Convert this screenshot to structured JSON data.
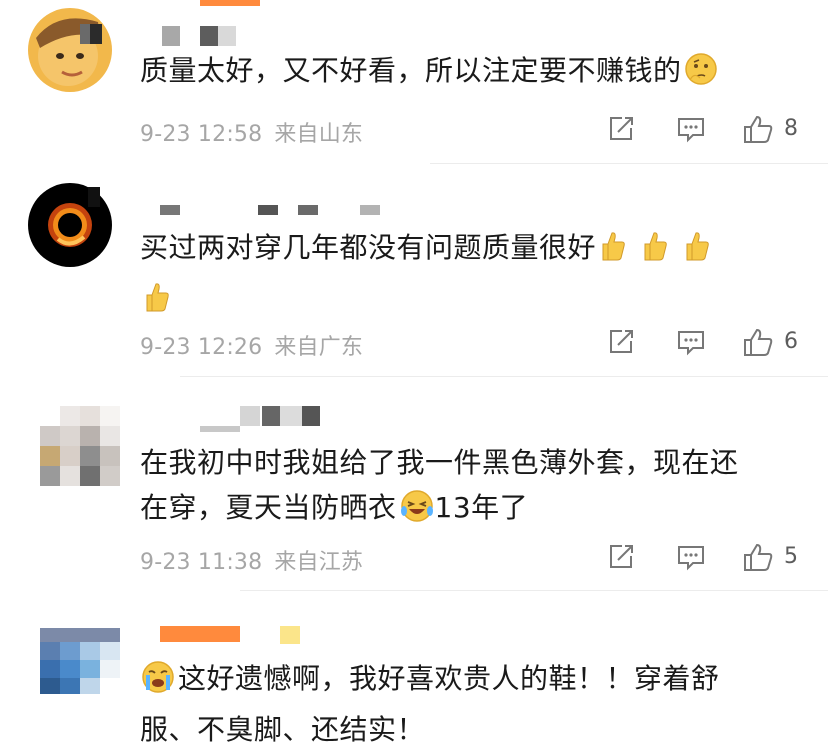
{
  "comments": [
    {
      "text": "质量太好，又不好看，所以注定要不赚钱的",
      "time": "9-23 12:58",
      "location": "来自山东",
      "likes": "8"
    },
    {
      "text": "买过两对穿几年都没有问题质量很好",
      "time": "9-23 12:26",
      "location": "来自广东",
      "likes": "6"
    },
    {
      "text_line1": "在我初中时我姐给了我一件黑色薄外套，现在还",
      "text_line2a": "在穿，夏天当防晒衣",
      "text_line2b": "13年了",
      "time": "9-23 11:38",
      "location": "来自江苏",
      "likes": "5"
    },
    {
      "text_line1": "这好遗憾啊，我好喜欢贵人的鞋！！穿着舒",
      "text_line2": "服、不臭脚、还结实！"
    }
  ],
  "icons": {
    "share": "share-icon",
    "reply": "comment-icon",
    "like": "thumbs-up-icon",
    "thinking": "thinking-emoji-icon",
    "thumbs": "thumbs-up-emoji-icon",
    "laugh_cry": "laugh-cry-emoji-icon",
    "crying": "crying-emoji-icon"
  },
  "colors": {
    "meta_gray": "#a6a6a6",
    "orange_accent": "#ff8a3d",
    "emoji_yellow": "#f7c948"
  }
}
